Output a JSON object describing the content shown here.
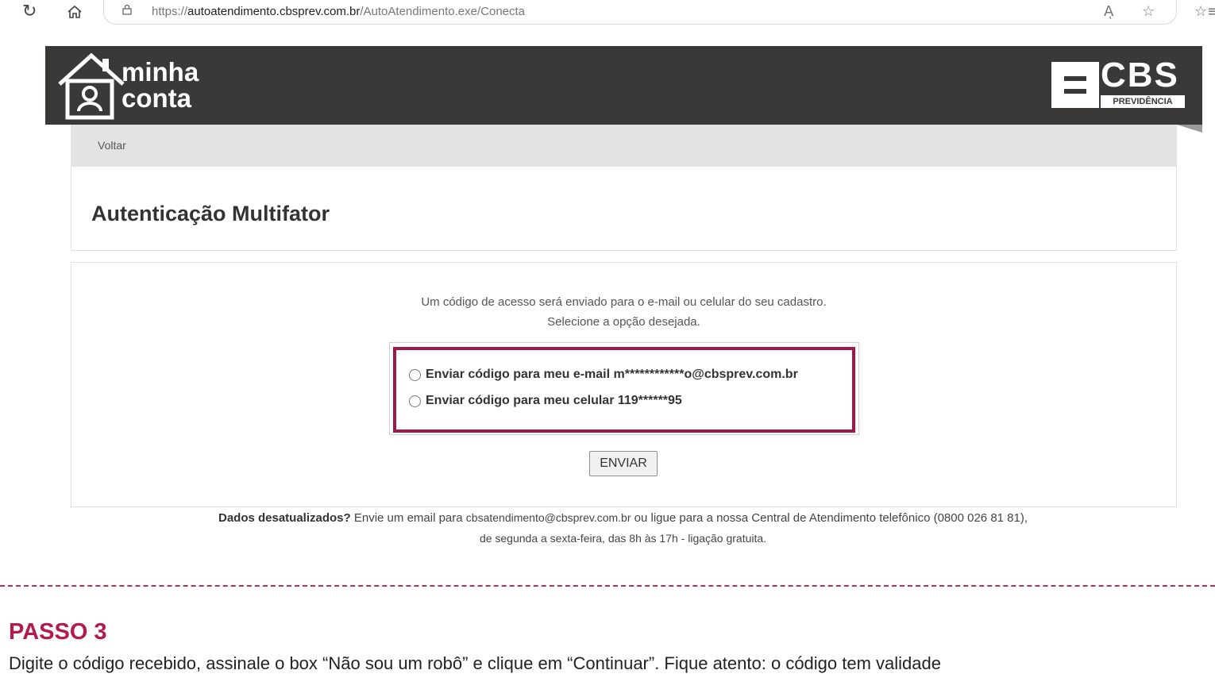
{
  "browser": {
    "url_scheme": "https://",
    "url_host": "autoatendimento.cbsprev.com.br",
    "url_path": "/AutoAtendimento.exe/Conecta",
    "read_aloud_label": "Aͅ",
    "icons": [
      "reload-icon",
      "home-icon",
      "lock-icon",
      "read-aloud-icon",
      "favorite-star-icon",
      "favorites-list-icon"
    ]
  },
  "header": {
    "logo_line1": "minha",
    "logo_line2": "conta",
    "brand_name": "CBS",
    "brand_sub": "PREVIDÊNCIA",
    "background_color": "#3b3938"
  },
  "nav": {
    "back_label": "Voltar"
  },
  "page": {
    "title": "Autenticação Multifator"
  },
  "auth": {
    "info_line1": "Um código de acesso será enviado para o e-mail ou celular do seu cadastro.",
    "info_line2": "Selecione a opção desejada.",
    "options": [
      {
        "label": "Enviar código para meu e-mail m************o@cbsprev.com.br",
        "selected": false
      },
      {
        "label": "Enviar código para meu celular 119******95",
        "selected": false
      }
    ],
    "highlight_color": "#a0174a",
    "submit_label": "ENVIAR"
  },
  "footer": {
    "lead": "Dados desatualizados?",
    "text_a": " Envie um email para ",
    "email": "cbsatendimento@cbsprev.com.br",
    "text_b": " ou ligue para a nossa Central de Atendimento telefônico (0800 026 81 81),",
    "line2": "de segunda a sexta-feira, das 8h às 17h - ligação gratuita."
  },
  "instructions": {
    "step_title": "PASSO 3",
    "step_text": "Digite o código recebido, assinale o box “Não sou um robô” e clique em “Continuar”. Fique atento: o código tem validade",
    "accent_color": "#b31b4d"
  }
}
